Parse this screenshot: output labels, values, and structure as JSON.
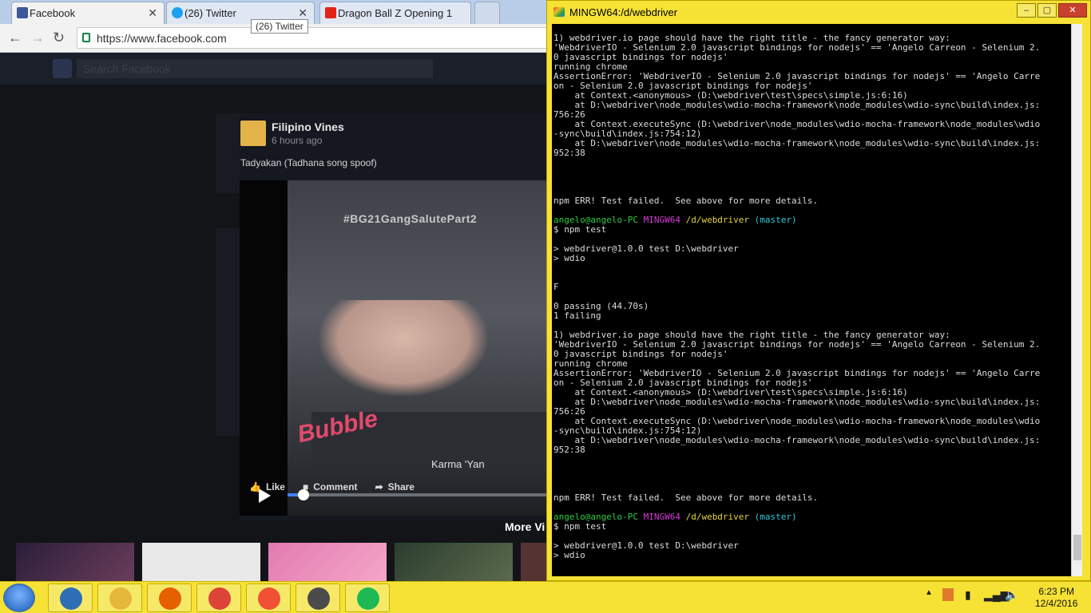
{
  "browser": {
    "tabs": [
      {
        "title": "Facebook",
        "favicon": "facebook-icon",
        "color": "#3b5998"
      },
      {
        "title": "(26) Twitter",
        "favicon": "twitter-icon",
        "color": "#1da1f2"
      },
      {
        "title": "Dragon Ball Z Opening 1",
        "favicon": "youtube-icon",
        "color": "#e62117"
      }
    ],
    "tooltip": "(26) Twitter",
    "url": "https://www.facebook.com"
  },
  "facebook": {
    "search_placeholder": "Search Facebook",
    "post": {
      "page_name": "Filipino Vines",
      "time": "6 hours ago",
      "text": "Tadyakan (Tadhana song spoof)",
      "video_overlay_hashtag": "#BG21GangSalutePart2",
      "video_overlay_logo": "Bubble",
      "video_overlay_caption": "Karma 'Yan",
      "progress": 0.05
    },
    "actions": {
      "like": "Like",
      "comment": "Comment",
      "share": "Share"
    },
    "more_videos_label": "More Vi"
  },
  "terminal": {
    "title": "MINGW64:/d/webdriver",
    "lines": [
      {
        "text": "1) webdriver.io page should have the right title - the fancy generator way:",
        "color": "#dcdcdc"
      },
      {
        "text": "'WebdriverIO - Selenium 2.0 javascript bindings for nodejs' == 'Angelo Carreon - Selenium 2.",
        "color": "#dcdcdc"
      },
      {
        "text": "0 javascript bindings for nodejs'",
        "color": "#dcdcdc"
      },
      {
        "text": "running chrome",
        "color": "#dcdcdc"
      },
      {
        "text": "AssertionError: 'WebdriverIO - Selenium 2.0 javascript bindings for nodejs' == 'Angelo Carre",
        "color": "#dcdcdc"
      },
      {
        "text": "on - Selenium 2.0 javascript bindings for nodejs'",
        "color": "#dcdcdc"
      },
      {
        "text": "    at Context.<anonymous> (D:\\webdriver\\test\\specs\\simple.js:6:16)",
        "color": "#dcdcdc"
      },
      {
        "text": "    at D:\\webdriver\\node_modules\\wdio-mocha-framework\\node_modules\\wdio-sync\\build\\index.js:",
        "color": "#dcdcdc"
      },
      {
        "text": "756:26",
        "color": "#dcdcdc"
      },
      {
        "text": "    at Context.executeSync (D:\\webdriver\\node_modules\\wdio-mocha-framework\\node_modules\\wdio",
        "color": "#dcdcdc"
      },
      {
        "text": "-sync\\build\\index.js:754:12)",
        "color": "#dcdcdc"
      },
      {
        "text": "    at D:\\webdriver\\node_modules\\wdio-mocha-framework\\node_modules\\wdio-sync\\build\\index.js:",
        "color": "#dcdcdc"
      },
      {
        "text": "952:38",
        "color": "#dcdcdc"
      },
      {
        "text": "",
        "color": "#dcdcdc"
      },
      {
        "text": "",
        "color": "#dcdcdc"
      },
      {
        "text": "",
        "color": "#dcdcdc"
      },
      {
        "text": "",
        "color": "#dcdcdc"
      },
      {
        "text": "npm ERR! Test failed.  See above for more details.",
        "color": "#dcdcdc"
      },
      {
        "text": "",
        "color": "#dcdcdc"
      },
      {
        "prompt": true,
        "user": "angelo@angelo-PC",
        "shell": "MINGW64",
        "path": "/d/webdriver",
        "branch": "(master)"
      },
      {
        "text": "$ npm test",
        "color": "#dcdcdc"
      },
      {
        "text": "",
        "color": "#dcdcdc"
      },
      {
        "text": "> webdriver@1.0.0 test D:\\webdriver",
        "color": "#dcdcdc"
      },
      {
        "text": "> wdio",
        "color": "#dcdcdc"
      },
      {
        "text": "",
        "color": "#dcdcdc"
      },
      {
        "text": "",
        "color": "#dcdcdc"
      },
      {
        "text": "F",
        "color": "#dcdcdc"
      },
      {
        "text": "",
        "color": "#dcdcdc"
      },
      {
        "text": "0 passing (44.70s)",
        "color": "#dcdcdc"
      },
      {
        "text": "1 failing",
        "color": "#dcdcdc"
      },
      {
        "text": "",
        "color": "#dcdcdc"
      },
      {
        "text": "1) webdriver.io page should have the right title - the fancy generator way:",
        "color": "#dcdcdc"
      },
      {
        "text": "'WebdriverIO - Selenium 2.0 javascript bindings for nodejs' == 'Angelo Carreon - Selenium 2.",
        "color": "#dcdcdc"
      },
      {
        "text": "0 javascript bindings for nodejs'",
        "color": "#dcdcdc"
      },
      {
        "text": "running chrome",
        "color": "#dcdcdc"
      },
      {
        "text": "AssertionError: 'WebdriverIO - Selenium 2.0 javascript bindings for nodejs' == 'Angelo Carre",
        "color": "#dcdcdc"
      },
      {
        "text": "on - Selenium 2.0 javascript bindings for nodejs'",
        "color": "#dcdcdc"
      },
      {
        "text": "    at Context.<anonymous> (D:\\webdriver\\test\\specs\\simple.js:6:16)",
        "color": "#dcdcdc"
      },
      {
        "text": "    at D:\\webdriver\\node_modules\\wdio-mocha-framework\\node_modules\\wdio-sync\\build\\index.js:",
        "color": "#dcdcdc"
      },
      {
        "text": "756:26",
        "color": "#dcdcdc"
      },
      {
        "text": "    at Context.executeSync (D:\\webdriver\\node_modules\\wdio-mocha-framework\\node_modules\\wdio",
        "color": "#dcdcdc"
      },
      {
        "text": "-sync\\build\\index.js:754:12)",
        "color": "#dcdcdc"
      },
      {
        "text": "    at D:\\webdriver\\node_modules\\wdio-mocha-framework\\node_modules\\wdio-sync\\build\\index.js:",
        "color": "#dcdcdc"
      },
      {
        "text": "952:38",
        "color": "#dcdcdc"
      },
      {
        "text": "",
        "color": "#dcdcdc"
      },
      {
        "text": "",
        "color": "#dcdcdc"
      },
      {
        "text": "",
        "color": "#dcdcdc"
      },
      {
        "text": "",
        "color": "#dcdcdc"
      },
      {
        "text": "npm ERR! Test failed.  See above for more details.",
        "color": "#dcdcdc"
      },
      {
        "text": "",
        "color": "#dcdcdc"
      },
      {
        "prompt": true,
        "user": "angelo@angelo-PC",
        "shell": "MINGW64",
        "path": "/d/webdriver",
        "branch": "(master)"
      },
      {
        "text": "$ npm test",
        "color": "#dcdcdc"
      },
      {
        "text": "",
        "color": "#dcdcdc"
      },
      {
        "text": "> webdriver@1.0.0 test D:\\webdriver",
        "color": "#dcdcdc"
      },
      {
        "text": "> wdio",
        "color": "#dcdcdc"
      }
    ],
    "colors": {
      "user": "#2ecc40",
      "shell": "#d63ad6",
      "path": "#e8d23a",
      "branch": "#2ec8d6"
    }
  },
  "taskbar": {
    "items": [
      {
        "name": "file-manager",
        "icon": "server-manager-icon",
        "color": "#2f6db5"
      },
      {
        "name": "explorer",
        "icon": "folder-icon",
        "color": "#e5b83a"
      },
      {
        "name": "firefox",
        "icon": "firefox-icon",
        "color": "#e66000"
      },
      {
        "name": "chrome",
        "icon": "chrome-icon",
        "color": "#db4437"
      },
      {
        "name": "git-bash",
        "icon": "git-icon",
        "color": "#f05033"
      },
      {
        "name": "sublime-text",
        "icon": "sublime-icon",
        "color": "#4b4b4b"
      },
      {
        "name": "spotify",
        "icon": "spotify-icon",
        "color": "#1db954"
      }
    ],
    "time": "6:23 PM",
    "date": "12/4/2016"
  }
}
